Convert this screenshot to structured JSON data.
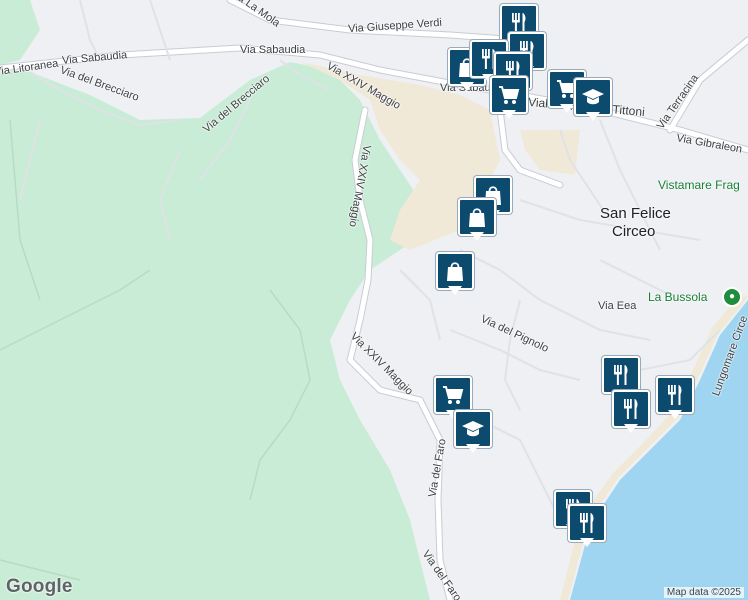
{
  "map": {
    "colors": {
      "background": "#eef0f3",
      "park": "#c9ecd6",
      "sand": "#f1e9d8",
      "sea": "#9fd5f0",
      "road": "#ffffff",
      "road_outline": "#c8ccd2",
      "marker": "#0c4a6e",
      "poi_green": "#1e8e3e"
    },
    "street_labels": [
      "Via Litoranea",
      "Via Sabaudia",
      "Via Sabaudia",
      "Via del Brecciaro",
      "Via del Brecciaro",
      "Via La Mola",
      "Via Giuseppe Verdi",
      "Via Sabaudia",
      "Viale Tommaso Tittoni",
      "Via Terracina",
      "Via Gibraleon",
      "Via XXIV Maggio",
      "Via XXIV Maggio",
      "Via XXIV Maggio",
      "Via Eea",
      "Via del Pignolo",
      "Lungomare Circe",
      "Via del Faro",
      "Via del Faro"
    ],
    "town_label": [
      "San Felice",
      "Circeo"
    ],
    "pois": [
      {
        "label": "Vistamare Frag",
        "icon": "none"
      },
      {
        "label": "La Bussola",
        "icon": "pin-icon"
      }
    ],
    "markers": [
      {
        "icon": "restaurant-icon"
      },
      {
        "icon": "restaurant-icon"
      },
      {
        "icon": "shopping-bag-icon"
      },
      {
        "icon": "restaurant-icon"
      },
      {
        "icon": "restaurant-icon"
      },
      {
        "icon": "shopping-cart-icon"
      },
      {
        "icon": "shopping-cart-icon"
      },
      {
        "icon": "education-icon"
      },
      {
        "icon": "shopping-bag-icon"
      },
      {
        "icon": "shopping-bag-icon"
      },
      {
        "icon": "shopping-bag-icon"
      },
      {
        "icon": "shopping-cart-icon"
      },
      {
        "icon": "education-icon"
      },
      {
        "icon": "restaurant-icon"
      },
      {
        "icon": "restaurant-icon"
      },
      {
        "icon": "restaurant-icon"
      },
      {
        "icon": "restaurant-icon"
      },
      {
        "icon": "restaurant-icon"
      }
    ],
    "branding": {
      "logo": "Google",
      "attribution": "Map data ©2025"
    }
  }
}
